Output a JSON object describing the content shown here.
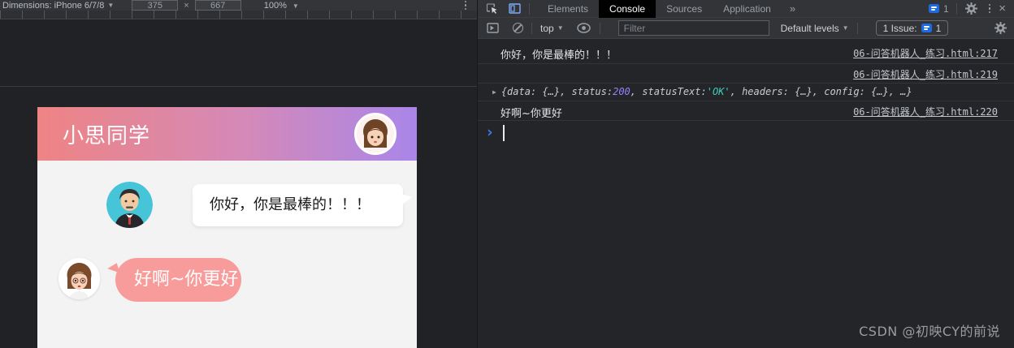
{
  "device_toolbar": {
    "dimensions_label": "Dimensions: iPhone 6/7/8",
    "width": "375",
    "multiply": "×",
    "height": "667",
    "zoom": "100%"
  },
  "phone": {
    "title": "小思同学",
    "message_user": "你好，你是最棒的！！！",
    "message_bot": "好啊~你更好"
  },
  "devtools": {
    "tabs": {
      "elements": "Elements",
      "console": "Console",
      "sources": "Sources",
      "application": "Application",
      "more": "»"
    },
    "tabbar_issue_count": "1",
    "toolbar": {
      "context": "top",
      "filter_placeholder": "Filter",
      "levels_label": "Default levels",
      "issues_label": "1 Issue:",
      "issues_count": "1"
    },
    "console": {
      "row1_text": "你好，你是最棒的！！！",
      "row1_link": "06-问答机器人_练习.html:217",
      "row2_link": "06-问答机器人_练习.html:219",
      "row3_expander": "▶",
      "row3_p1": "{data: {…}, status: ",
      "row3_num": "200",
      "row3_p2": ", statusText: ",
      "row3_str": "'OK'",
      "row3_p3": ", headers: {…}, config: {…}, …}",
      "row4_text": "好啊~你更好",
      "row4_link": "06-问答机器人_练习.html:220",
      "prompt": "›"
    }
  },
  "watermark": "CSDN @初映CY的前说",
  "colors": {
    "header_gradient_start": "#ee8484",
    "header_gradient_end": "#a986e9",
    "pink_bubble": "#f89b9b",
    "man_avatar_bg": "#45c5d7",
    "accent_blue": "#7cacf8",
    "issue_blue": "#1e6ae5",
    "number_purple": "#9980ff",
    "string_teal": "#3fd0bd"
  }
}
